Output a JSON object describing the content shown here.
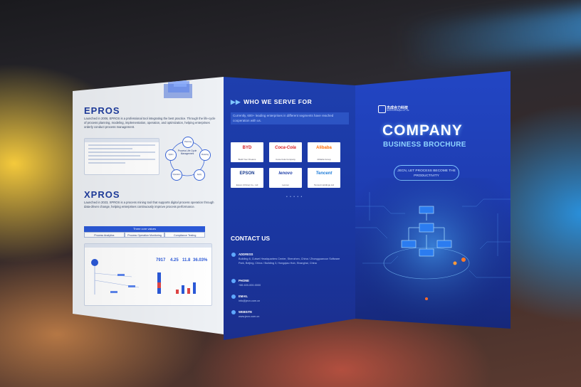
{
  "left_panel": {
    "epros": {
      "title": "EPROS",
      "description": "Launched in 2006, EPROS is a professional tool integrating the best practice. Through the life-cycle of process planning, modeling, implementation, operation, and optimization, helping enterprises orderly conduct process management.",
      "cycle_center": "Process Life Cycle Management",
      "cycle_nodes": [
        "Planning",
        "Modeling",
        "Apply",
        "Operation",
        "Optim"
      ]
    },
    "xpros": {
      "title": "XPROS",
      "description": "Launched in 2023, XPROS is a process mining tool that supports digital process operation through data-driven change, helping enterprises continuously improve process performance.",
      "core_values_title": "Three core values",
      "core_values": [
        "Process Analytics",
        "Process Operation Monitoring",
        "Compliance Testing"
      ],
      "kpis": [
        "7917",
        "4.25",
        "11.8",
        "36.03%"
      ]
    }
  },
  "mid_panel": {
    "who_title": "WHO WE SERVE FOR",
    "who_desc": "Currently, 600+ leading enterprises in different segments have reached cooperation with us.",
    "clients": [
      {
        "brand": "BYD",
        "caption": "Build Your Dreams",
        "color": "#d21d26"
      },
      {
        "brand": "Coca-Cola",
        "caption": "Coca-Cola Company",
        "color": "#d71920"
      },
      {
        "brand": "Alibaba",
        "caption": "Alibaba Group",
        "color": "#ff6a00"
      },
      {
        "brand": "EPSON",
        "caption": "Epson (China) Co., Ltd",
        "color": "#163a8e"
      },
      {
        "brand": "lenovo",
        "caption": "Lenovo",
        "color": "#1f3fa8"
      },
      {
        "brand": "Tencent",
        "caption": "Tencent Holdings Ltd",
        "color": "#1a7ad8"
      }
    ],
    "more": "• • • • •",
    "contact_title": "CONTACT US",
    "contacts": [
      {
        "label": "ADDRESS",
        "value": "Building 6, Cuiwei Headquarters Center, Shenzhen, China / Zhongguancun Software Park, Beijing, China / Building 3, Hongqiao Hub, Shanghai, China"
      },
      {
        "label": "PHONE",
        "value": "+86 400-000-0000"
      },
      {
        "label": "EMAIL",
        "value": "info@jecn.com.cn"
      },
      {
        "label": "WEBSITE",
        "value": "www.jecn.com.cn"
      }
    ]
  },
  "right_panel": {
    "logo_name": "杰成合力科技",
    "logo_sub": "JECN Technologies Co., Ltd.",
    "title_line1": "COMPANY",
    "title_line2": "BUSINESS BROCHURE",
    "slogan": "JECN, LET PROCESS BECOME THE PRODUCTIVITY"
  },
  "colors": {
    "brand_blue": "#1e3fae",
    "accent_cyan": "#8fd4ff",
    "panel_light": "#eef1f5"
  }
}
